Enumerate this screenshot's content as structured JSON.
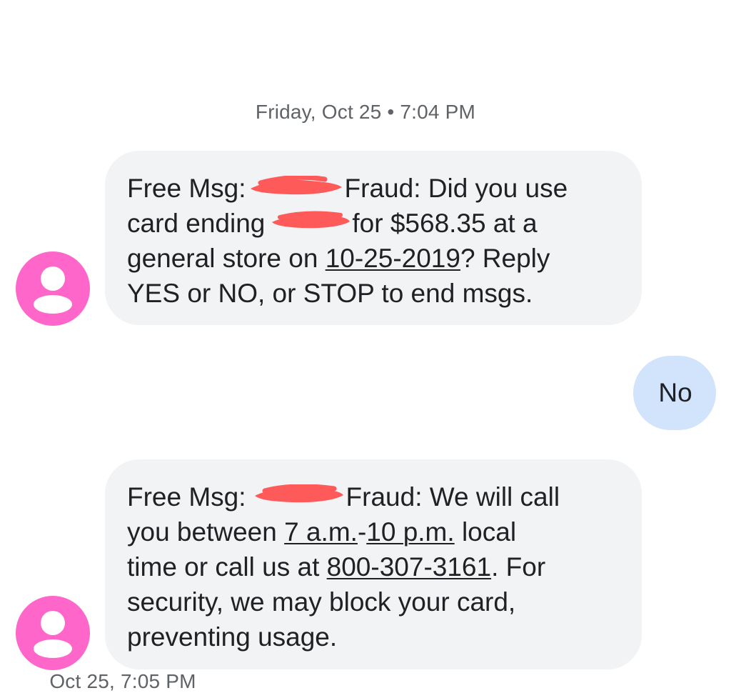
{
  "conversation": {
    "timestamps": [
      "Friday, Oct 25 • 7:04 PM",
      "Oct 25, 7:05 PM"
    ],
    "messages": [
      {
        "direction": "incoming",
        "avatar_icon": "person-icon",
        "lines": [
          {
            "pre": "Free Msg:",
            "post": "Fraud: Did you use"
          },
          {
            "pre": "card ending",
            "post": "for $568.35 at a"
          },
          {
            "pre": "general store on ",
            "link": "10-25-2019",
            "post": "? Reply"
          },
          {
            "text": "YES or NO, or STOP to end msgs."
          }
        ]
      },
      {
        "direction": "outgoing",
        "text": "No"
      },
      {
        "direction": "incoming",
        "avatar_icon": "person-icon",
        "lines": [
          {
            "pre": "Free Msg:",
            "post": "Fraud: We will call"
          },
          {
            "pre": "you between ",
            "link1": "7 a.m.",
            "mid": "-",
            "link2": "10 p.m.",
            "post": " local"
          },
          {
            "pre": "time or call us at ",
            "link": "800-307-3161",
            "post": ". For"
          },
          {
            "text": "security, we may block your card,"
          },
          {
            "text": "preventing usage."
          }
        ]
      }
    ]
  },
  "colors": {
    "incoming_bubble": "#f1f3f4",
    "outgoing_bubble": "#d2e3fc",
    "avatar": "#ff66c9",
    "redaction": "#ff5a5a",
    "timestamp_text": "#5f6368",
    "message_text": "#202124"
  }
}
